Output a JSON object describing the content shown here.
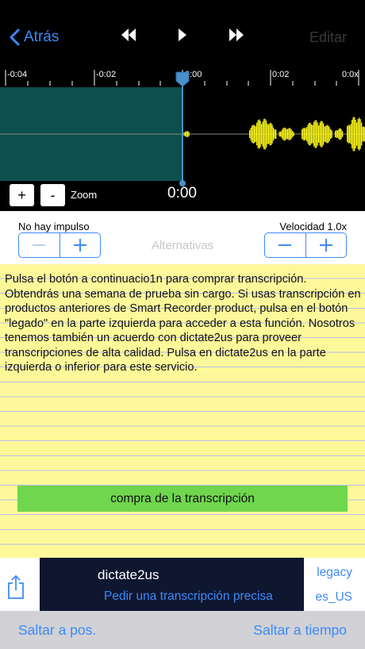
{
  "nav": {
    "back_label": "Atrás",
    "edit_label": "Editar"
  },
  "timeline": {
    "ticks": [
      "-0:04",
      "-0:02",
      "0:00",
      "0:02",
      "0:0x"
    ]
  },
  "zoom": {
    "plus": "+",
    "minus": "-",
    "label": "Zoom",
    "time": "0:00"
  },
  "controls": {
    "impulse_label": "No hay impulso",
    "speed_label": "Velocidad 1.0x",
    "alternatives": "Alternativas"
  },
  "pad": {
    "text": "Pulsa el botón a continuacio1n para comprar transcripción. Obtendrás una semana de prueba sin cargo. Si usas transcripción en productos anteriores de Smart Recorder product,  pulsa en el botón \"legado\" en la parte izquierda para acceder a esta función. Nosotros tenemos también un acuerdo con dictate2us para proveer transcripciones de alta calidad. Pulsa en dictate2us en la parte izquierda o inferior para este servicio.",
    "buy_label": "compra de la transcripción"
  },
  "dictate": {
    "title": "dictate2us",
    "subtitle": "Pedir una transcripción precisa",
    "legacy": "legacy",
    "locale": "es_US"
  },
  "bottom": {
    "jump_pos": "Saltar a pos.",
    "jump_time": "Saltar a tiempo"
  },
  "colors": {
    "accent": "#3d8af7",
    "recorded_region": "#0c4f4c",
    "waveform": "#f5f11a",
    "pad": "#fdf99a",
    "buy_button": "#6fd64e",
    "promo_bg": "#0f1630"
  }
}
